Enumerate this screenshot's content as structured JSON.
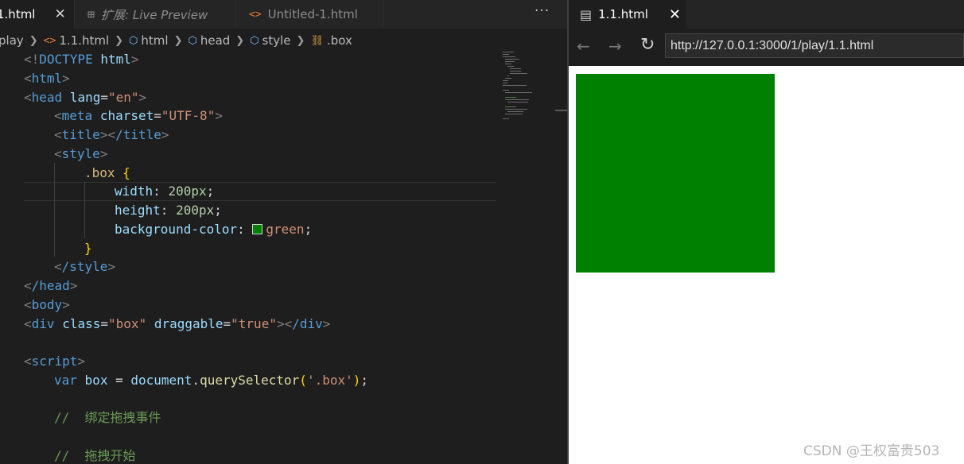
{
  "editor": {
    "tabs": [
      {
        "label": "1.html",
        "close": "✕"
      },
      {
        "icon": "⊞",
        "label": "扩展: Live Preview"
      },
      {
        "icon": "<>",
        "label": "Untitled-1.html"
      }
    ],
    "more": "···",
    "breadcrumb": [
      "play",
      "1.1.html",
      "html",
      "head",
      "style",
      ".box"
    ],
    "colors": {
      "background": "#1e1e1e",
      "tag": "#569cd6",
      "attr": "#9cdcfe",
      "string": "#ce9178",
      "comment": "#6a9955"
    }
  },
  "code": {
    "l1_open": "<!",
    "l1_kw": "DOCTYPE",
    "l1_name": "html",
    "l1_close": ">",
    "l2": "html",
    "l3_tag": "head",
    "l3_attr": "lang",
    "l3_val": "\"en\"",
    "l4_tag": "meta",
    "l4_attr": "charset",
    "l4_val": "\"UTF-8\"",
    "l5_open": "title",
    "l5_close": "/title",
    "l6": "style",
    "l7_sel": ".box",
    "l7_brace": "{",
    "l8_prop": "width",
    "l8_val": "200px",
    "l9_prop": "height",
    "l9_val": "200px",
    "l10_prop": "background-color",
    "l10_val": "green",
    "l11_brace": "}",
    "l12": "/style",
    "l13": "/head",
    "l14": "body",
    "l15_tag": "div",
    "l15_attr1": "class",
    "l15_val1": "\"box\"",
    "l15_attr2": "draggable",
    "l15_val2": "\"true\"",
    "l15_end": "/div",
    "l17": "script",
    "l18_kw": "var",
    "l18_var": "box",
    "l18_obj": "document",
    "l18_fn": "querySelector",
    "l18_arg": "'.box'",
    "l20": "//  绑定拖拽事件",
    "l22": "//  拖拽开始"
  },
  "preview": {
    "tab_label": "1.1.html",
    "tab_close": "✕",
    "url": "http://127.0.0.1:3000/1/play/1.1.html",
    "box_color": "#008000"
  },
  "watermark": "CSDN @王权富贵503"
}
